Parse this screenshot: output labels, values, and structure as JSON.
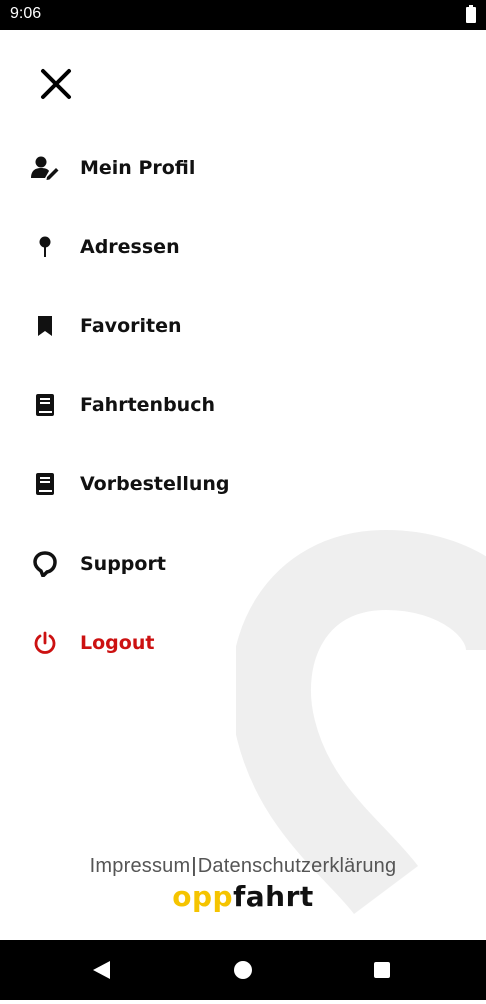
{
  "status_bar": {
    "time": "9:06",
    "battery_icon": "battery-full-icon"
  },
  "header": {
    "close_icon": "close-icon"
  },
  "menu": {
    "items": [
      {
        "label": "Mein Profil",
        "icon": "user-edit-icon"
      },
      {
        "label": "Adressen",
        "icon": "map-pin-icon"
      },
      {
        "label": "Favoriten",
        "icon": "bookmark-icon"
      },
      {
        "label": "Fahrtenbuch",
        "icon": "book-icon"
      },
      {
        "label": "Vorbestellung",
        "icon": "book-icon"
      },
      {
        "label": "Support",
        "icon": "support-logo-icon"
      },
      {
        "label": "Logout",
        "icon": "power-icon",
        "color": "#cc1111"
      }
    ]
  },
  "footer": {
    "impressum": "Impressum",
    "separator": "|",
    "datenschutz": "Datenschutzerklärung",
    "brand_prefix": "opp",
    "brand_suffix": "fahrt",
    "brand_colors": {
      "prefix": "#f5c400",
      "suffix": "#111111"
    }
  },
  "nav_bar": {
    "back_icon": "back-triangle-icon",
    "home_icon": "home-circle-icon",
    "recents_icon": "recents-square-icon"
  }
}
